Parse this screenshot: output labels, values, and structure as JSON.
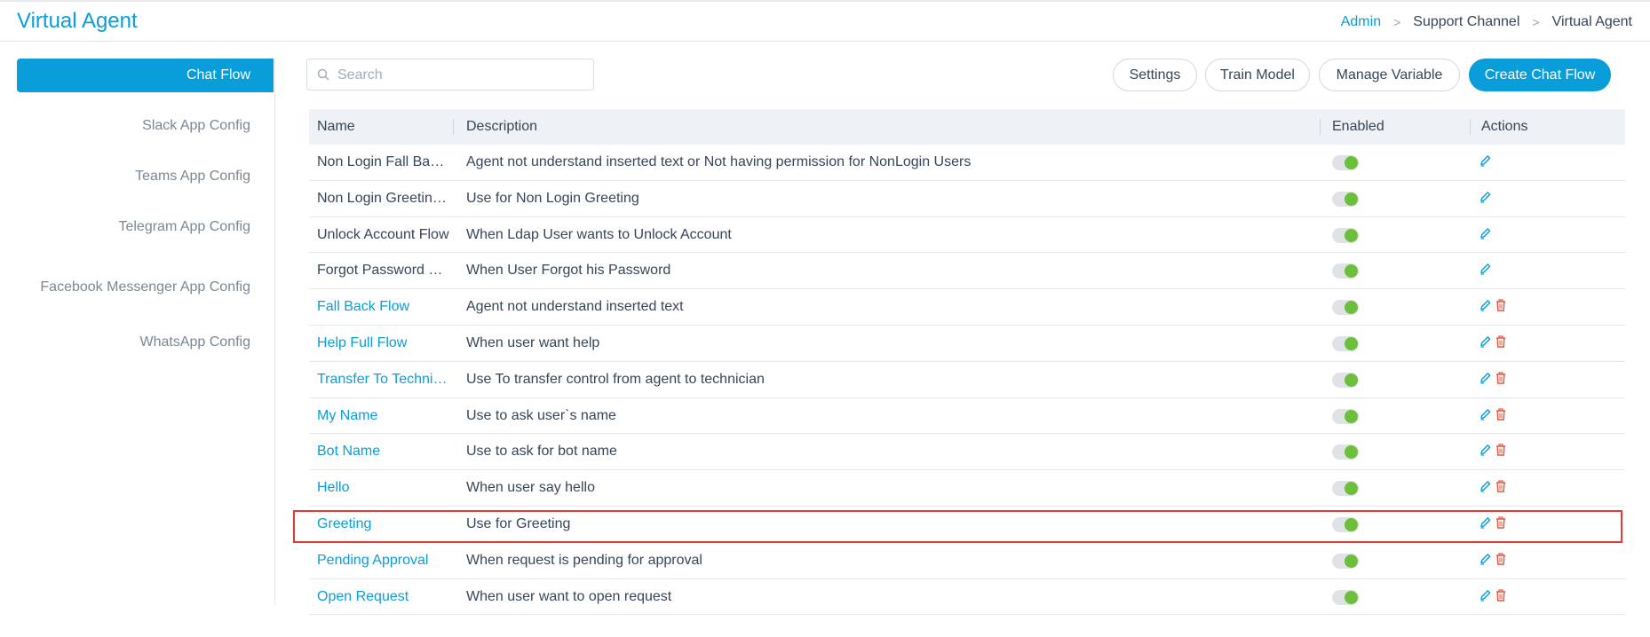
{
  "app": {
    "title": "Virtual Agent"
  },
  "breadcrumb": [
    "Admin",
    "Support Channel",
    "Virtual Agent"
  ],
  "sidebar": {
    "items": [
      {
        "label": "Chat Flow",
        "active": true
      },
      {
        "label": "Slack App Config"
      },
      {
        "label": "Teams App Config"
      },
      {
        "label": "Telegram App Config"
      },
      {
        "label": "Facebook Messenger App Config"
      },
      {
        "label": "WhatsApp Config"
      }
    ]
  },
  "search": {
    "placeholder": "Search",
    "value": ""
  },
  "toolbar": {
    "settings_label": "Settings",
    "train_model_label": "Train Model",
    "manage_variable_label": "Manage Variable",
    "create_chat_flow_label": "Create Chat Flow"
  },
  "table": {
    "columns": {
      "name": "Name",
      "description": "Description",
      "enabled": "Enabled",
      "actions": "Actions"
    },
    "rows": [
      {
        "name": "Non Login Fall Back ...",
        "description": "Agent not understand inserted text or Not having permission for NonLogin Users",
        "enabled": true,
        "deletable": false,
        "link": false
      },
      {
        "name": "Non Login Greeting ...",
        "description": "Use for Non Login Greeting",
        "enabled": true,
        "deletable": false,
        "link": false
      },
      {
        "name": "Unlock Account Flow",
        "description": "When Ldap User wants to Unlock Account",
        "enabled": true,
        "deletable": false,
        "link": false
      },
      {
        "name": "Forgot Password Fl...",
        "description": "When User Forgot his Password",
        "enabled": true,
        "deletable": false,
        "link": false
      },
      {
        "name": "Fall Back Flow",
        "description": "Agent not understand inserted text",
        "enabled": true,
        "deletable": true,
        "link": true
      },
      {
        "name": "Help Full Flow",
        "description": "When user want help",
        "enabled": true,
        "deletable": true,
        "link": true
      },
      {
        "name": "Transfer To Technic...",
        "description": "Use To transfer control from agent to technician",
        "enabled": true,
        "deletable": true,
        "link": true
      },
      {
        "name": "My Name",
        "description": "Use to ask user`s name",
        "enabled": true,
        "deletable": true,
        "link": true
      },
      {
        "name": "Bot Name",
        "description": "Use to ask for bot name",
        "enabled": true,
        "deletable": true,
        "link": true
      },
      {
        "name": "Hello",
        "description": "When user say hello",
        "enabled": true,
        "deletable": true,
        "link": true
      },
      {
        "name": "Greeting",
        "description": "Use for Greeting",
        "enabled": true,
        "deletable": true,
        "link": true,
        "highlighted": true
      },
      {
        "name": "Pending Approval",
        "description": "When request is pending for approval",
        "enabled": true,
        "deletable": true,
        "link": true
      },
      {
        "name": "Open Request",
        "description": "When user want to open request",
        "enabled": true,
        "deletable": true,
        "link": true
      }
    ]
  },
  "colors": {
    "accent": "#099dd9",
    "toggle_on": "#6cbf3a",
    "delete": "#e0563f",
    "highlight": "#e53935"
  },
  "icons": {
    "search": "search-icon",
    "edit": "pencil-icon",
    "delete": "trash-icon",
    "breadcrumb_separator": "chevron-right-icon"
  }
}
